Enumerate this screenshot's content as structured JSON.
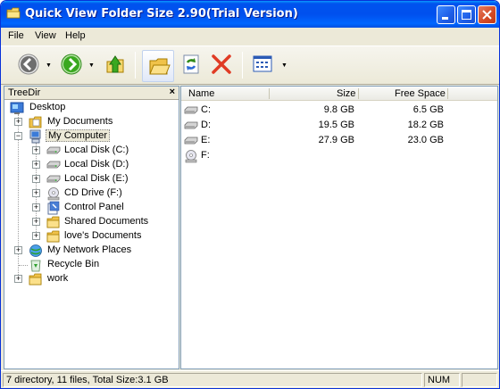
{
  "window": {
    "title": "Quick View Folder Size 2.90(Trial Version)"
  },
  "menu": [
    "File",
    "View",
    "Help"
  ],
  "toolbar": {
    "icons": [
      "back-icon",
      "forward-icon",
      "up-folder-icon",
      "folder-icon",
      "refresh-icon",
      "delete-icon",
      "view-mode-icon"
    ]
  },
  "tree": {
    "title": "TreeDir",
    "close": "×",
    "nodes": [
      {
        "label": "Desktop"
      },
      {
        "label": "My Documents"
      },
      {
        "label": "My Computer"
      },
      {
        "label": "Local Disk (C:)"
      },
      {
        "label": "Local Disk (D:)"
      },
      {
        "label": "Local Disk (E:)"
      },
      {
        "label": "CD Drive (F:)"
      },
      {
        "label": "Control Panel"
      },
      {
        "label": "Shared Documents"
      },
      {
        "label": "love's Documents"
      },
      {
        "label": "My Network Places"
      },
      {
        "label": "Recycle Bin"
      },
      {
        "label": "work"
      }
    ]
  },
  "list": {
    "columns": [
      "Name",
      "Size",
      "Free Space"
    ],
    "rows": [
      {
        "name": "C:",
        "size": "9.8 GB",
        "free": "6.5 GB"
      },
      {
        "name": "D:",
        "size": "19.5 GB",
        "free": "18.2 GB"
      },
      {
        "name": "E:",
        "size": "27.9 GB",
        "free": "23.0 GB"
      },
      {
        "name": "F:",
        "size": "",
        "free": ""
      }
    ]
  },
  "status": {
    "summary": "7 directory, 11 files, Total Size:3.1 GB",
    "num": "NUM"
  },
  "colors": {
    "title_bar": "#0054e3",
    "selection": "#ece9d8"
  }
}
